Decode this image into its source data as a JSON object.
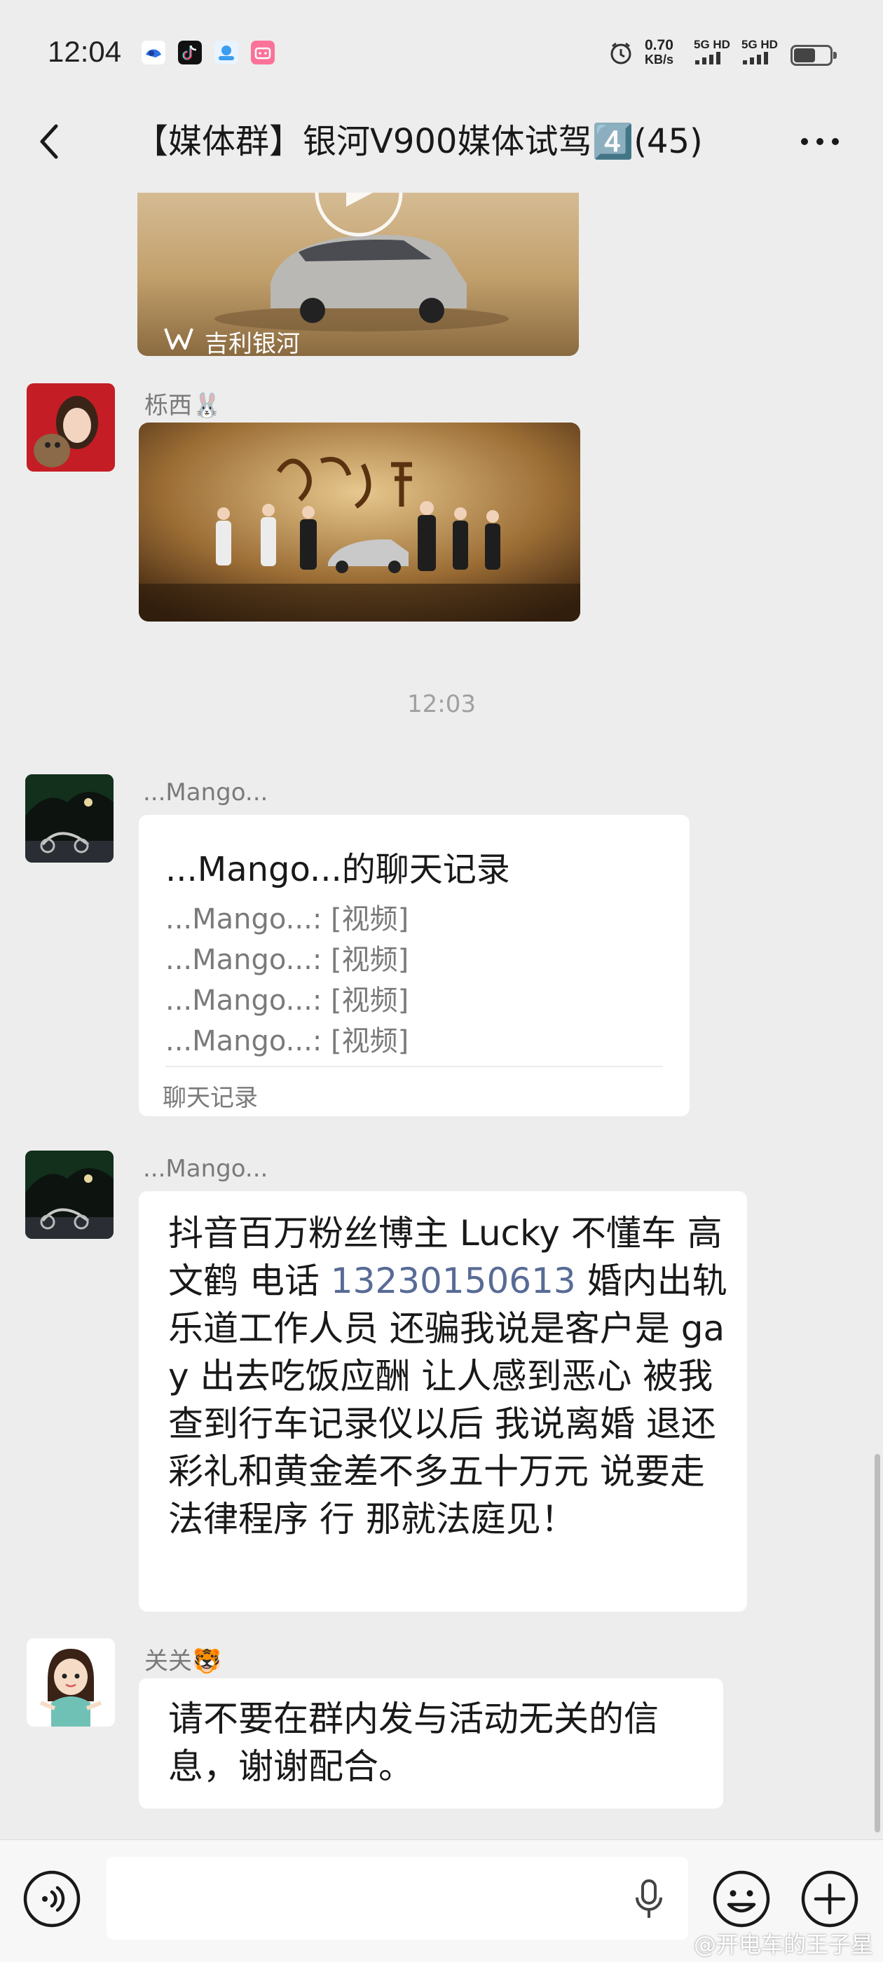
{
  "status_bar": {
    "time": "12:04",
    "net_speed_value": "0.70",
    "net_speed_unit": "KB/s",
    "signal_1": "5G HD",
    "signal_2": "5G HD",
    "app_icons": [
      "baidu-icon",
      "douyin-icon",
      "app-icon",
      "bilibili-icon"
    ]
  },
  "header": {
    "title": "【媒体群】银河V900媒体试驾4️⃣(45)",
    "back_icon": "chevron-left-icon",
    "more_icon": "more-dots-icon"
  },
  "messages": {
    "video_1": {
      "brand_text": "吉利银河"
    },
    "msg_2": {
      "sender": "栎西🐰"
    },
    "time_divider": "12:03",
    "msg_3": {
      "sender": "...Mango...",
      "record_title": "...Mango...的聊天记录",
      "record_lines": [
        "...Mango...: [视频]",
        "...Mango...: [视频]",
        "...Mango...: [视频]",
        "...Mango...: [视频]"
      ],
      "record_footer": "聊天记录"
    },
    "msg_4": {
      "sender": "...Mango...",
      "text_before_phone": "抖音百万粉丝博主 Lucky 不懂车 高文鹤 电话 ",
      "phone": "13230150613",
      "text_after_phone": " 婚内出轨乐道工作人员 还骗我说是客户是 gay 出去吃饭应酬 让人感到恶心 被我查到行车记录仪以后 我说离婚 退还彩礼和黄金差不多五十万元 说要走法律程序 行 那就法庭见！"
    },
    "msg_5": {
      "sender": "关关🐯",
      "text": "请不要在群内发与活动无关的信息，谢谢配合。"
    }
  },
  "input_bar": {
    "voice_icon": "voice-mode-icon",
    "mic_icon": "microphone-icon",
    "emoji_icon": "emoji-icon",
    "plus_icon": "plus-icon"
  },
  "watermark": "@开电车的王子星",
  "colors": {
    "background": "#ededed",
    "bubble": "#ffffff",
    "link": "#576b95",
    "meta_text": "#7a7a7a"
  }
}
